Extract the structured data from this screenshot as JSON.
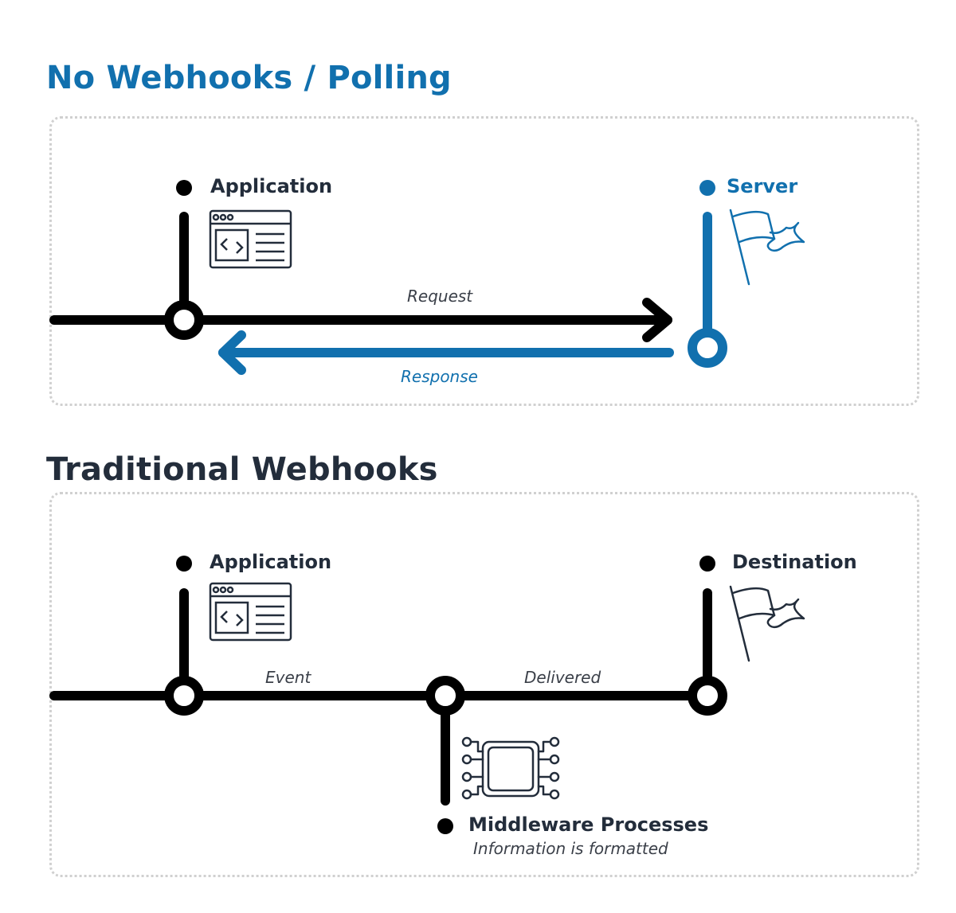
{
  "sections": [
    {
      "title": "No Webhooks / Polling",
      "nodes": {
        "application": {
          "label": "Application",
          "icon": "browser-code-icon"
        },
        "server": {
          "label": "Server",
          "icon": "flag-icon"
        }
      },
      "edges": {
        "request": {
          "label": "Request",
          "direction": "application-to-server"
        },
        "response": {
          "label": "Response",
          "direction": "server-to-application"
        }
      }
    },
    {
      "title": "Traditional Webhooks",
      "nodes": {
        "application": {
          "label": "Application",
          "icon": "browser-code-icon"
        },
        "destination": {
          "label": "Destination",
          "icon": "flag-icon"
        },
        "middleware": {
          "label": "Middleware Processes",
          "sublabel": "Information is formatted",
          "icon": "chip-icon"
        }
      },
      "edges": {
        "event": {
          "label": "Event"
        },
        "delivered": {
          "label": "Delivered"
        }
      }
    }
  ],
  "colors": {
    "accent_blue": "#1170ae",
    "dark_text": "#232d3b",
    "line_black": "#000000",
    "border_dots": "#d0d0d0"
  }
}
